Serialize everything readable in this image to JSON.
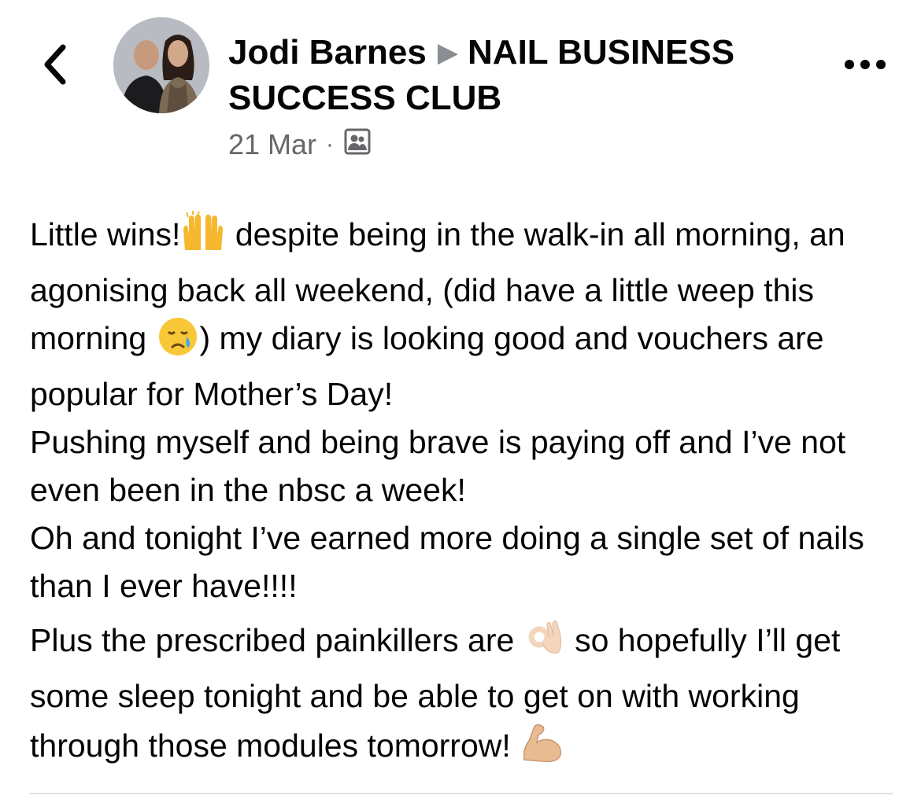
{
  "header": {
    "author_name": "Jodi Barnes",
    "group_name": "NAIL BUSINESS SUCCESS CLUB",
    "date": "21 Mar",
    "separator": "·",
    "audience_icon": "group-audience-icon",
    "back_icon": "chevron-left-icon",
    "more_icon": "more-horizontal-icon"
  },
  "post": {
    "line1_a": "Little wins!",
    "line1_b": " despite being in the walk-in all morning, an agonising back all weekend, (did have a little weep this morning ",
    "line1_c": ") my diary is looking good and vouchers are popular for Mother’s Day!",
    "line2": "Pushing myself and being brave is paying off and I’ve not even been in the nbsc a week!",
    "line3": "Oh and tonight I’ve earned more doing a single set of nails than I ever have!!!!",
    "line4_a": "Plus the prescribed painkillers are ",
    "line4_b": " so hopefully I’ll get some sleep tonight and be able to get on with working through those modules tomorrow! ",
    "emojis": {
      "raised_hands": "raising-hands-emoji",
      "crying_face": "crying-face-emoji",
      "ok_hand": "ok-hand-emoji",
      "flexed_biceps": "flexed-biceps-emoji"
    }
  },
  "colors": {
    "text": "#050505",
    "secondary_text": "#65676b",
    "divider": "#dddfe2"
  }
}
